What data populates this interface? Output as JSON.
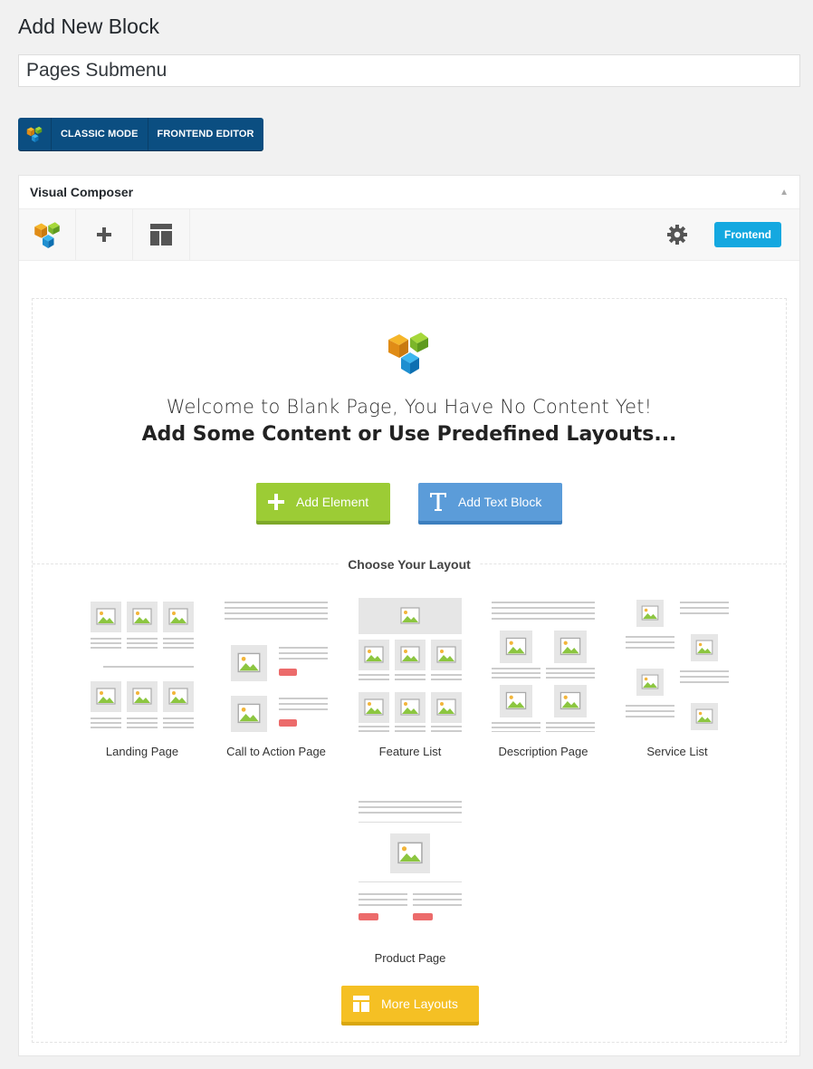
{
  "page": {
    "title": "Add New Block"
  },
  "post_title": {
    "value": "Pages Submenu"
  },
  "mode_bar": {
    "classic_label": "CLASSIC MODE",
    "frontend_label": "FRONTEND EDITOR"
  },
  "postbox": {
    "title": "Visual Composer"
  },
  "toolbar": {
    "frontend_label": "Frontend",
    "icons": [
      "vc-logo-icon",
      "plus-icon",
      "templates-icon",
      "gear-icon"
    ]
  },
  "empty_state": {
    "welcome_line1": "Welcome to Blank Page, You Have No Content Yet!",
    "welcome_line2": "Add Some Content or Use Predefined Layouts...",
    "add_element_label": "Add Element",
    "add_text_block_label": "Add Text Block",
    "choose_layout": "Choose Your Layout",
    "more_layouts_label": "More Layouts"
  },
  "layouts": [
    {
      "label": "Landing Page"
    },
    {
      "label": "Call to Action Page"
    },
    {
      "label": "Feature List"
    },
    {
      "label": "Description Page"
    },
    {
      "label": "Service List"
    },
    {
      "label": "Product Page"
    }
  ],
  "colors": {
    "add_element": "#9ccc35",
    "add_text_block": "#5b9cd9",
    "more_layouts": "#f5c024",
    "frontend": "#14a8e0",
    "mode_bar": "#0b4e81",
    "cta_red": "#ec6b6b"
  }
}
